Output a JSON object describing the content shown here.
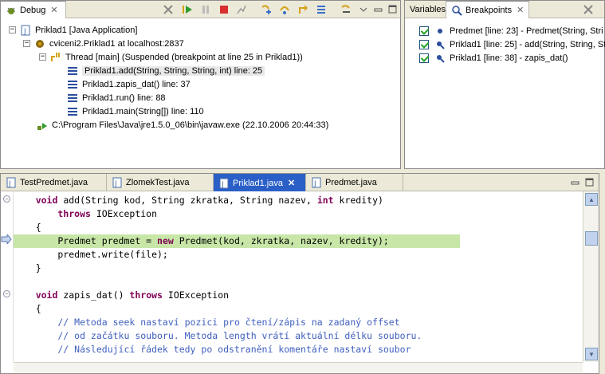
{
  "debug_view": {
    "title": "Debug",
    "tree": [
      {
        "label": "Priklad1 [Java Application]"
      },
      {
        "label": "cviceni2.Priklad1 at localhost:2837"
      },
      {
        "label": "Thread [main] (Suspended (breakpoint at line 25 in Priklad1))"
      },
      {
        "label": "Priklad1.add(String, String, String, int) line: 25"
      },
      {
        "label": "Priklad1.zapis_dat() line: 37"
      },
      {
        "label": "Priklad1.run() line: 88"
      },
      {
        "label": "Priklad1.main(String[]) line: 110"
      },
      {
        "label": "C:\\Program Files\\Java\\jre1.5.0_06\\bin\\javaw.exe (22.10.2006 20:44:33)"
      }
    ]
  },
  "breakpoints_view": {
    "tab_variables": "Variables",
    "tab_breakpoints": "Breakpoints",
    "items": [
      {
        "label": "Predmet [line: 23] - Predmet(String, Stri"
      },
      {
        "label": "Priklad1 [line: 25] - add(String, String, St"
      },
      {
        "label": "Priklad1 [line: 38] - zapis_dat()"
      }
    ]
  },
  "editor": {
    "tabs": [
      {
        "label": "TestPredmet.java"
      },
      {
        "label": "ZlomekTest.java"
      },
      {
        "label": "Priklad1.java"
      },
      {
        "label": "Predmet.java"
      }
    ]
  },
  "colors": {
    "keyword": "#7f0055",
    "comment": "#3f5fbf",
    "current_line": "#c7e6a7",
    "active_tab": "#2a5fc7"
  }
}
